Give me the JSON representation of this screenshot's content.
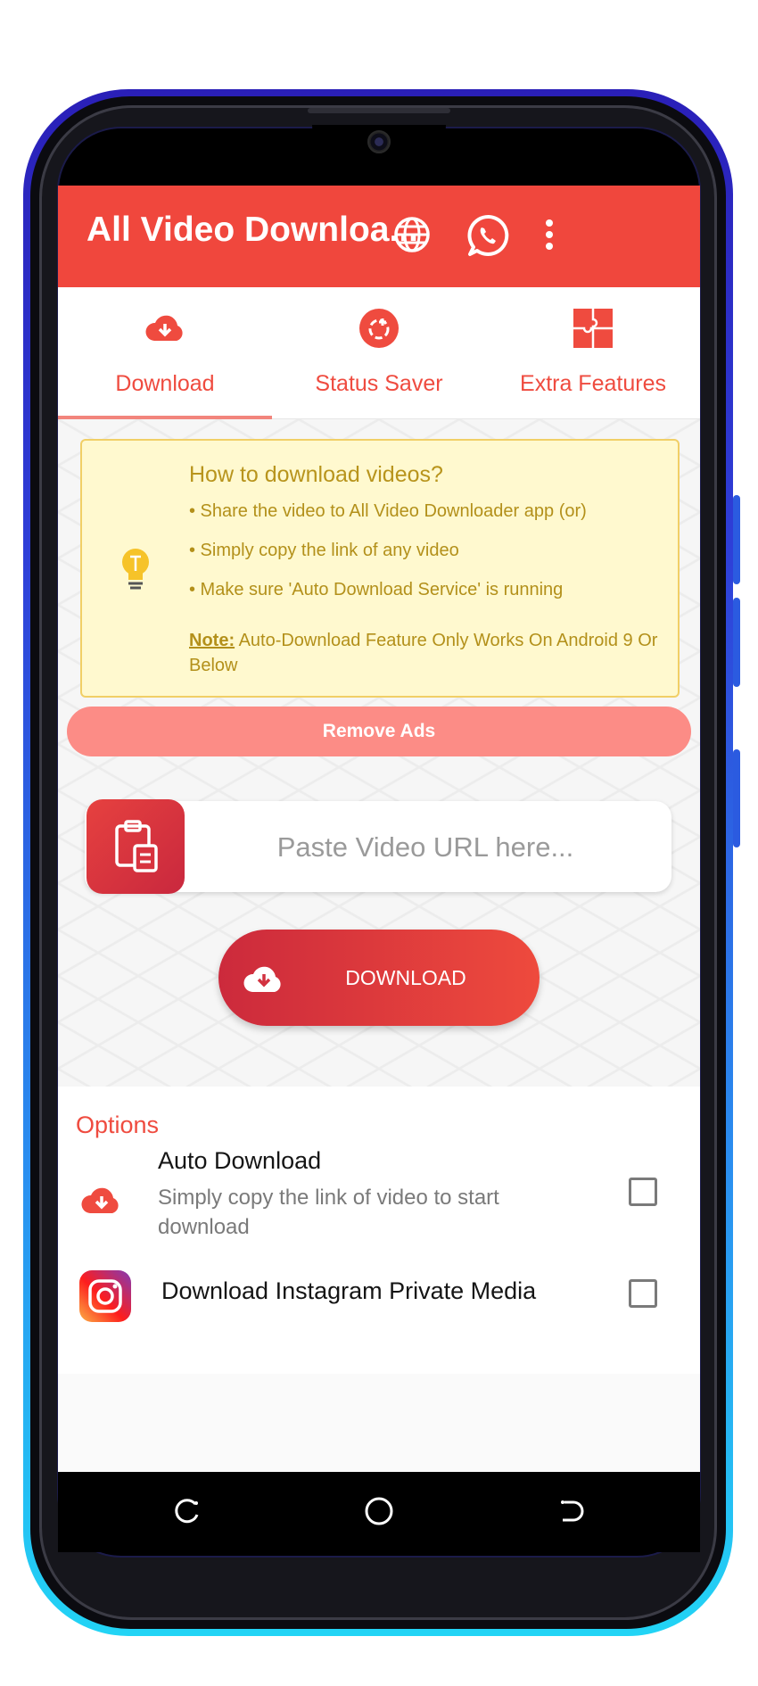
{
  "app": {
    "title": "All Video Downloa...",
    "accent_color": "#f0473d",
    "toolbar_icons": [
      "globe-icon",
      "whatsapp-icon",
      "more-vert-icon"
    ]
  },
  "tabs": [
    {
      "label": "Download",
      "icon": "cloud-download-icon",
      "selected": true
    },
    {
      "label": "Status Saver",
      "icon": "status-saver-icon",
      "selected": false
    },
    {
      "label": "Extra Features",
      "icon": "puzzle-icon",
      "selected": false
    }
  ],
  "howto": {
    "title": "How to download videos?",
    "lines": [
      "• Share the video to All Video Downloader app (or)",
      "• Simply copy the link of any video",
      "• Make sure 'Auto Download Service' is running"
    ],
    "note_label": "Note:",
    "note_text": " Auto-Download Feature Only Works On Android 9 Or Below",
    "icon": "lightbulb-icon"
  },
  "remove_ads": {
    "label": "Remove Ads"
  },
  "url_input": {
    "placeholder": "Paste Video URL here...",
    "value": ""
  },
  "download_button": {
    "label": "DOWNLOAD"
  },
  "options": {
    "title": "Options",
    "items": [
      {
        "title": "Auto Download",
        "description": "Simply copy the link of video to start download",
        "checked": false,
        "icon": "cloud-download-icon"
      },
      {
        "title": "Download Instagram Private Media",
        "description": "",
        "checked": false,
        "icon": "instagram-icon"
      }
    ]
  }
}
